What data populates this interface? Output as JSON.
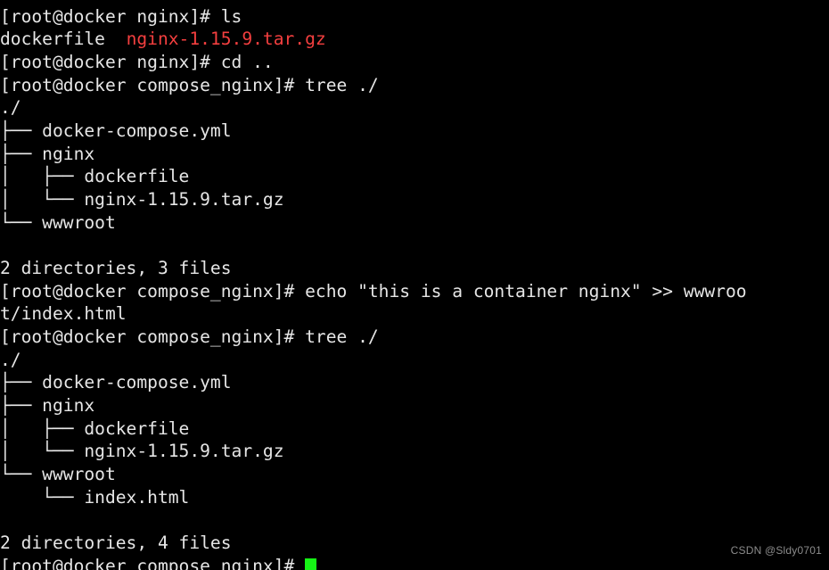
{
  "terminal": {
    "background_color": "#000000",
    "foreground_color": "#e6e6e6",
    "archive_color": "#f43f3f",
    "cursor_color": "#16f316",
    "prompt_host": "[root@docker nginx]#",
    "prompt_host_parent": "[root@docker compose_nginx]#",
    "columns": 71,
    "lines": [
      {
        "id": "l00",
        "text": ""
      },
      {
        "id": "l01",
        "text": "[root@docker nginx]# ls"
      },
      {
        "id": "l02",
        "text": "dockerfile  ",
        "archive": "nginx-1.15.9.tar.gz"
      },
      {
        "id": "l03",
        "text": "[root@docker nginx]# cd .."
      },
      {
        "id": "l04",
        "text": "[root@docker compose_nginx]# tree ./"
      },
      {
        "id": "l05",
        "text": "./"
      },
      {
        "id": "l06",
        "text": "├── docker-compose.yml"
      },
      {
        "id": "l07",
        "text": "├── nginx"
      },
      {
        "id": "l08",
        "text": "│   ├── dockerfile"
      },
      {
        "id": "l09",
        "text": "│   └── nginx-1.15.9.tar.gz"
      },
      {
        "id": "l10",
        "text": "└── wwwroot"
      },
      {
        "id": "l11",
        "text": ""
      },
      {
        "id": "l12",
        "text": "2 directories, 3 files"
      },
      {
        "id": "l13",
        "text": "[root@docker compose_nginx]# echo \"this is a container nginx\" >> wwwroo"
      },
      {
        "id": "l14",
        "text": "t/index.html"
      },
      {
        "id": "l15",
        "text": "[root@docker compose_nginx]# tree ./"
      },
      {
        "id": "l16",
        "text": "./"
      },
      {
        "id": "l17",
        "text": "├── docker-compose.yml"
      },
      {
        "id": "l18",
        "text": "├── nginx"
      },
      {
        "id": "l19",
        "text": "│   ├── dockerfile"
      },
      {
        "id": "l20",
        "text": "│   └── nginx-1.15.9.tar.gz"
      },
      {
        "id": "l21",
        "text": "└── wwwroot"
      },
      {
        "id": "l22",
        "text": "    └── index.html"
      },
      {
        "id": "l23",
        "text": ""
      },
      {
        "id": "l24",
        "text": "2 directories, 4 files"
      },
      {
        "id": "l25",
        "text": "[root@docker compose_nginx]# "
      }
    ]
  },
  "watermark": {
    "text": "CSDN @Sldy0701"
  }
}
